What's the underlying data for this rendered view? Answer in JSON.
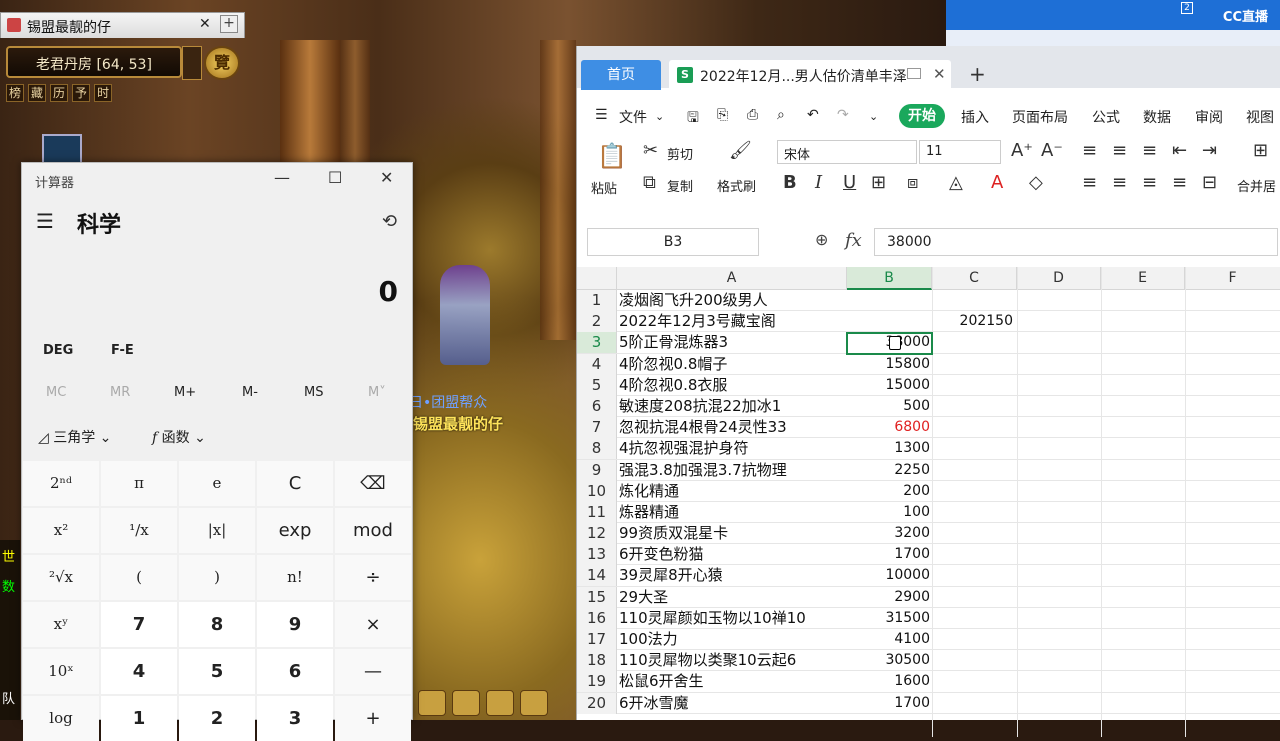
{
  "game": {
    "tab_title": "锡盟最靓的仔",
    "location": "老君丹房 [64, 53]",
    "badge": "覽",
    "mini_menu": [
      "榜",
      "藏",
      "历",
      "予",
      "时"
    ],
    "chat_line": "看日•团盟帮众",
    "player_name": "锡盟最靓的仔",
    "left_edge_chars": [
      "世",
      "数",
      "队"
    ]
  },
  "overlay": {
    "logo": "CC直播",
    "counter": "2"
  },
  "calculator": {
    "title": "计算器",
    "mode": "科学",
    "display": "0",
    "angle_mode": "DEG",
    "notation": "F-E",
    "memory": [
      "MC",
      "MR",
      "M+",
      "M-",
      "MS",
      "M˅"
    ],
    "trig_label": "三角学",
    "func_label": "函数",
    "keys": [
      [
        "2ⁿᵈ",
        "π",
        "e",
        "C",
        "⌫"
      ],
      [
        "x²",
        "¹∕x",
        "|x|",
        "exp",
        "mod"
      ],
      [
        "²√x",
        "(",
        ")",
        "n!",
        "÷"
      ],
      [
        "xʸ",
        "7",
        "8",
        "9",
        "×"
      ],
      [
        "10ˣ",
        "4",
        "5",
        "6",
        "—"
      ],
      [
        "log",
        "1",
        "2",
        "3",
        "+"
      ]
    ]
  },
  "spreadsheet": {
    "home_tab": "首页",
    "doc_icon": "S",
    "doc_title": "2022年12月...男人估价清单丰泽",
    "menu": {
      "file": "文件",
      "start": "开始",
      "insert": "插入",
      "layout": "页面布局",
      "formula": "公式",
      "data": "数据",
      "review": "审阅",
      "view": "视图"
    },
    "ribbon": {
      "cut": "剪切",
      "paste": "粘贴",
      "copy": "复制",
      "format_painter": "格式刷",
      "font": "宋体",
      "size": "11",
      "merge": "合并居"
    },
    "namebox": "B3",
    "fx": "fx",
    "formula_value": "38000",
    "columns": [
      "A",
      "B",
      "C",
      "D",
      "E",
      "F"
    ],
    "rows": [
      {
        "n": "1",
        "a": "凌烟阁飞升200级男人",
        "b": "",
        "c": ""
      },
      {
        "n": "2",
        "a": "2022年12月3号藏宝阁",
        "b": "",
        "c": "202150"
      },
      {
        "n": "3",
        "a": "5阶正骨混炼器3",
        "b": "38000",
        "c": ""
      },
      {
        "n": "4",
        "a": "4阶忽视0.8帽子",
        "b": "15800",
        "c": ""
      },
      {
        "n": "5",
        "a": "4阶忽视0.8衣服",
        "b": "15000",
        "c": ""
      },
      {
        "n": "6",
        "a": "敏速度208抗混22加冰1",
        "b": "500",
        "c": ""
      },
      {
        "n": "7",
        "a": "忽视抗混4根骨24灵性33",
        "b": "6800",
        "c": ""
      },
      {
        "n": "8",
        "a": "4抗忽视强混护身符",
        "b": "1300",
        "c": ""
      },
      {
        "n": "9",
        "a": "强混3.8加强混3.7抗物理",
        "b": "2250",
        "c": ""
      },
      {
        "n": "10",
        "a": "炼化精通",
        "b": "200",
        "c": ""
      },
      {
        "n": "11",
        "a": "炼器精通",
        "b": "100",
        "c": ""
      },
      {
        "n": "12",
        "a": "99资质双混星卡",
        "b": "3200",
        "c": ""
      },
      {
        "n": "13",
        "a": "6开变色粉猫",
        "b": "1700",
        "c": ""
      },
      {
        "n": "14",
        "a": "39灵犀8开心猿",
        "b": "10000",
        "c": ""
      },
      {
        "n": "15",
        "a": "29大圣",
        "b": "2900",
        "c": ""
      },
      {
        "n": "16",
        "a": "110灵犀颜如玉物以10禅10",
        "b": "31500",
        "c": ""
      },
      {
        "n": "17",
        "a": "100法力",
        "b": "4100",
        "c": ""
      },
      {
        "n": "18",
        "a": "110灵犀物以类聚10云起6",
        "b": "30500",
        "c": ""
      },
      {
        "n": "19",
        "a": "松鼠6开舍生",
        "b": "1600",
        "c": ""
      },
      {
        "n": "20",
        "a": "6开冰雪魔",
        "b": "1700",
        "c": ""
      }
    ],
    "red_value_color": "#e02020",
    "accent": "#1aa85c"
  }
}
